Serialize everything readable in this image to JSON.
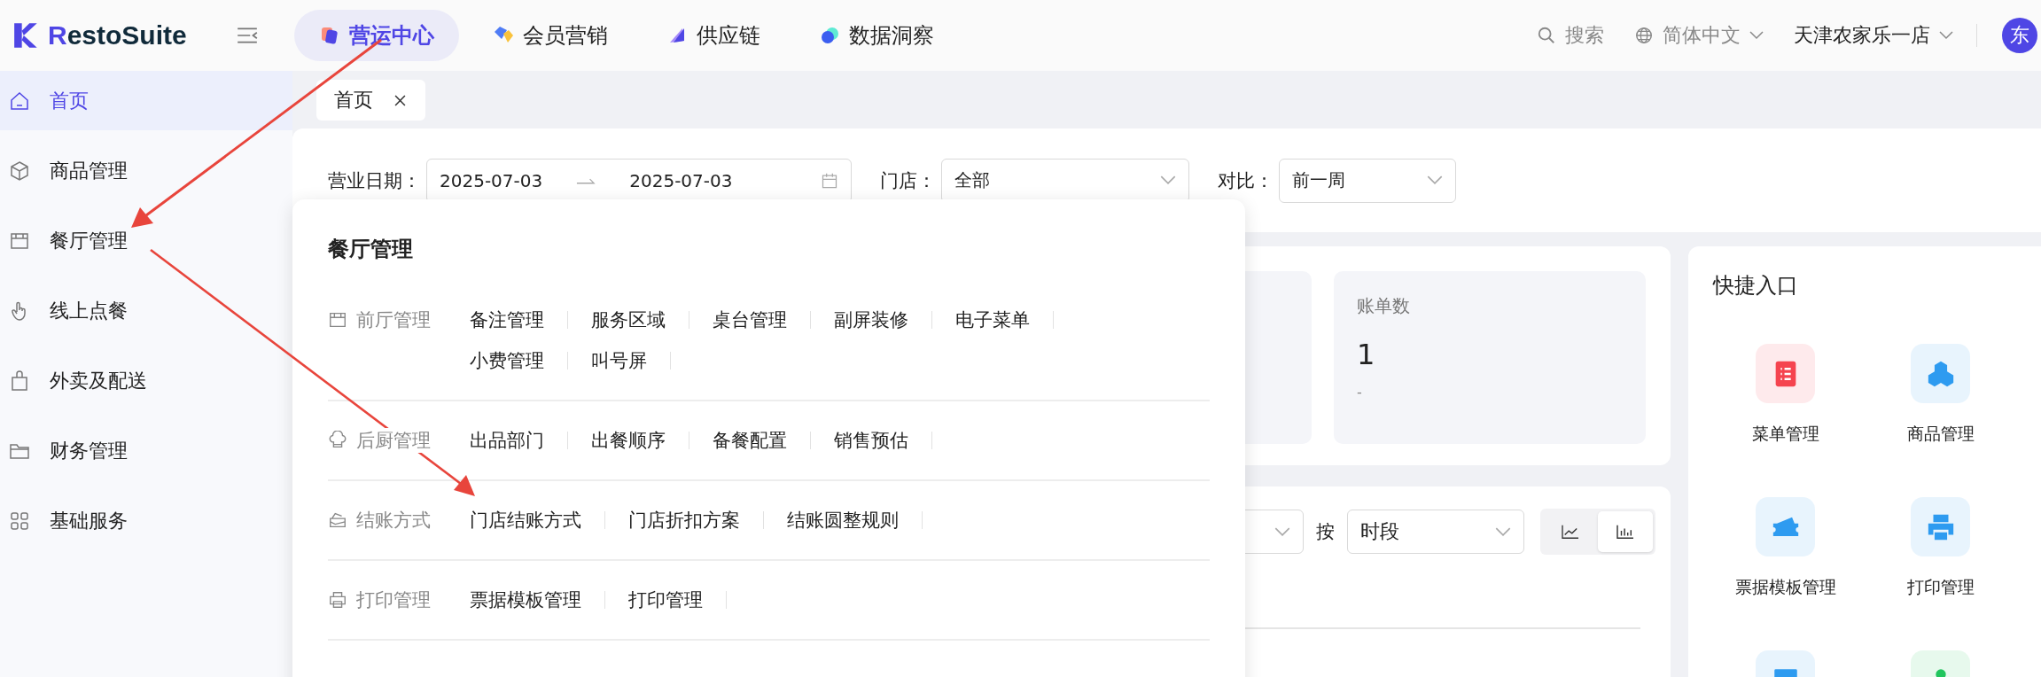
{
  "header": {
    "brand": "RestoSuite",
    "modules": [
      {
        "label": "营运中心",
        "selected": true
      },
      {
        "label": "会员营销",
        "selected": false
      },
      {
        "label": "供应链",
        "selected": false
      },
      {
        "label": "数据洞察",
        "selected": false
      }
    ],
    "search": "搜索",
    "language": "简体中文",
    "store": "天津农家乐一店",
    "avatar": "东"
  },
  "sidebar": {
    "items": [
      {
        "label": "首页",
        "selected": true
      },
      {
        "label": "商品管理",
        "selected": false
      },
      {
        "label": "餐厅管理",
        "selected": false
      },
      {
        "label": "线上点餐",
        "selected": false
      },
      {
        "label": "外卖及配送",
        "selected": false
      },
      {
        "label": "财务管理",
        "selected": false
      },
      {
        "label": "基础服务",
        "selected": false
      }
    ]
  },
  "page_tabs": [
    {
      "label": "首页",
      "selected": true
    }
  ],
  "filters": {
    "date_label": "营业日期：",
    "date_start": "2025-07-03",
    "date_end": "2025-07-03",
    "store_label": "门店：",
    "store_value": "全部",
    "compare_label": "对比：",
    "compare_value": "前一周"
  },
  "stats": [
    {
      "title": "账单数",
      "value": "1",
      "change": "-"
    }
  ],
  "chart_controls": {
    "by_label": "按",
    "period": "时段",
    "chart_types": [
      {
        "kind": "line",
        "selected": false
      },
      {
        "kind": "bar",
        "selected": true
      }
    ]
  },
  "quick_entry": {
    "title": "快捷入口",
    "items": [
      {
        "label": "菜单管理",
        "color": "#f5444f"
      },
      {
        "label": "商品管理",
        "color": "#2e9bf0"
      },
      {
        "label": "票据模板管理",
        "color": "#2e9bf0"
      },
      {
        "label": "打印管理",
        "color": "#2e9bf0"
      },
      {
        "color": "#2e9bf0"
      },
      {
        "color": "#22c55e"
      }
    ]
  },
  "menu_popup": {
    "title": "餐厅管理",
    "groups": [
      {
        "label": "前厅管理",
        "links": [
          "备注管理",
          "服务区域",
          "桌台管理",
          "副屏装修",
          "电子菜单",
          "小费管理",
          "叫号屏"
        ]
      },
      {
        "label": "后厨管理",
        "links": [
          "出品部门",
          "出餐顺序",
          "备餐配置",
          "销售预估"
        ]
      },
      {
        "label": "结账方式",
        "links": [
          "门店结账方式",
          "门店折扣方案",
          "结账圆整规则"
        ]
      },
      {
        "label": "打印管理",
        "links": [
          "票据模板管理",
          "打印管理"
        ]
      }
    ]
  }
}
